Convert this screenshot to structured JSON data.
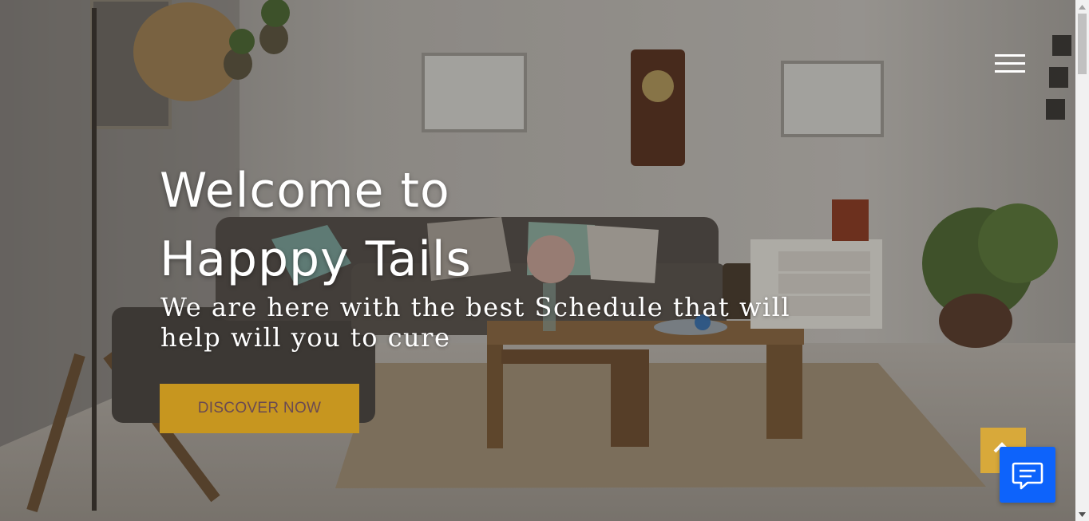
{
  "hero": {
    "headline_line1": "Welcome to",
    "headline_line2": "Happpy Tails",
    "subtitle_line1": "We are here with the best Schedule that will",
    "subtitle_line2": "help will you to cure",
    "cta_label": "DISCOVER NOW"
  },
  "icons": {
    "menu": "hamburger-menu-icon",
    "scroll_top": "chevron-up-icon",
    "chat": "chat-bubble-icon"
  },
  "colors": {
    "cta_background": "#c7961f",
    "cta_text": "#6a4a52",
    "scroll_top_background": "#d8a93a",
    "chat_background": "#0d63fb"
  }
}
